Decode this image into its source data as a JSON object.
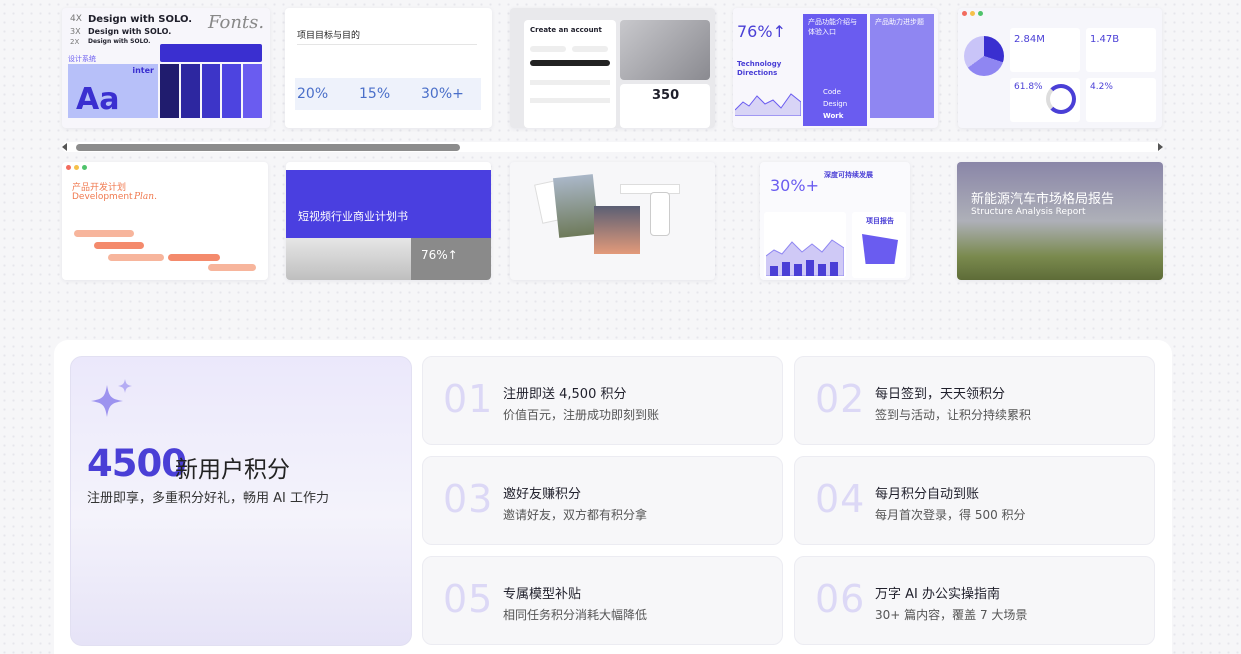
{
  "gallery": {
    "c1": {
      "scale": [
        "4X",
        "3X",
        "2X"
      ],
      "line1": "Design with SOLO.",
      "line2": "Design with SOLO.",
      "line3": "Design with SOLO.",
      "fonts": "Fonts.",
      "label": "设计系统",
      "font_name": "inter",
      "aa": "Aa"
    },
    "c2": {
      "title": "项目目标与目的",
      "stats": [
        "20%",
        "15%",
        "30%+"
      ]
    },
    "c3": {
      "title": "Create an account",
      "number": "350"
    },
    "c4": {
      "pct": "76%↑",
      "dir1": "Technology",
      "dir2": "Directions",
      "tile1": "产品功能介绍与体验入口",
      "tile2": "产品助力进步题",
      "menu": [
        "Code",
        "Design",
        "Work"
      ]
    },
    "c5": {
      "v1": "2.84M",
      "v2": "1.47B",
      "v3": "61.8%",
      "v4": "4.2%"
    },
    "c6": {
      "title": "产品开发计划",
      "sub": "Development",
      "sub2": "Plan."
    },
    "c7": {
      "title": "短视频行业商业计划书",
      "pct": "76%↑"
    },
    "c9": {
      "title": "深度可持续发展",
      "pct": "30%+",
      "sub": "项目报告"
    },
    "c10": {
      "title": "新能源汽车市场格局报告",
      "sub": "Structure Analysis Report"
    }
  },
  "hero": {
    "number": "4500",
    "title": "新用户积分",
    "subtitle": "注册即享，多重积分好礼，畅用 AI 工作力"
  },
  "features": [
    {
      "num": "01",
      "title": "注册即送 4,500 积分",
      "desc": "价值百元，注册成功即刻到账"
    },
    {
      "num": "02",
      "title": "每日签到，天天领积分",
      "desc": "签到与活动，让积分持续累积"
    },
    {
      "num": "03",
      "title": "邀好友赚积分",
      "desc": "邀请好友，双方都有积分拿"
    },
    {
      "num": "04",
      "title": "每月积分自动到账",
      "desc": "每月首次登录，得 500 积分"
    },
    {
      "num": "05",
      "title": "专属模型补贴",
      "desc": "相同任务积分消耗大幅降低"
    },
    {
      "num": "06",
      "title": "万字 AI 办公实操指南",
      "desc": "30+ 篇内容，覆盖 7 大场景"
    }
  ],
  "colors": {
    "accent": "#4a3fd6",
    "tile": "#6a5cf0"
  }
}
